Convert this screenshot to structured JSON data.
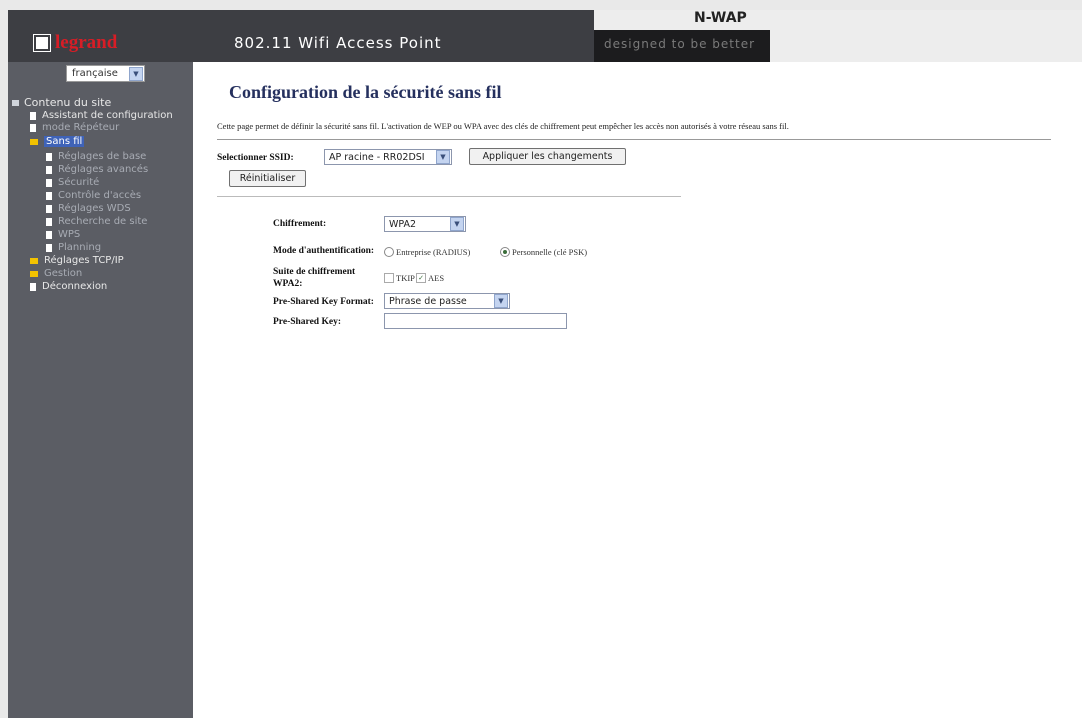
{
  "header": {
    "brand": "legrand",
    "product_title": "802.11 Wifi Access Point",
    "model": "N-WAP",
    "slogan": "designed to be better"
  },
  "sidebar": {
    "language": "française",
    "root": "Contenu du site",
    "items": [
      {
        "label": "Assistant de configuration",
        "type": "page"
      },
      {
        "label": "mode Répéteur",
        "type": "page"
      },
      {
        "label": "Sans fil",
        "type": "folder"
      },
      {
        "label": "Réglages de base",
        "type": "page"
      },
      {
        "label": "Réglages avancés",
        "type": "page"
      },
      {
        "label": "Sécurité",
        "type": "page"
      },
      {
        "label": "Contrôle d'accès",
        "type": "page"
      },
      {
        "label": "Réglages WDS",
        "type": "page"
      },
      {
        "label": "Recherche de site",
        "type": "page"
      },
      {
        "label": "WPS",
        "type": "page"
      },
      {
        "label": "Planning",
        "type": "page"
      },
      {
        "label": "Réglages TCP/IP",
        "type": "folder"
      },
      {
        "label": "Gestion",
        "type": "folder"
      },
      {
        "label": "Déconnexion",
        "type": "page"
      }
    ]
  },
  "main": {
    "title": "Configuration de la sécurité sans fil",
    "description": "Cette page permet de définir la sécurité sans fil. L'activation de WEP ou WPA avec des clés de chiffrement peut empêcher les accès non autorisés à votre réseau sans fil.",
    "ssid_label": "Selectionner SSID:",
    "ssid_value": "AP racine - RR02DSI",
    "apply_button": "Appliquer les changements",
    "reset_button": "Réinitialiser",
    "encryption_label": "Chiffrement:",
    "encryption_value": "WPA2",
    "auth_mode_label": "Mode d'authentification:",
    "auth_options": [
      "Entreprise (RADIUS)",
      "Personnelle (clé PSK)"
    ],
    "auth_selected": "Personnelle (clé PSK)",
    "cipher_label_line1": "Suite de chiffrement",
    "cipher_label_line2": "WPA2:",
    "cipher_options": [
      {
        "label": "TKIP",
        "checked": false
      },
      {
        "label": "AES",
        "checked": true
      }
    ],
    "psk_format_label": "Pre-Shared Key Format:",
    "psk_format_value": "Phrase de passe",
    "psk_label": "Pre-Shared Key:",
    "psk_value": ""
  },
  "colors": {
    "header_dark": "#3d3e43",
    "sidebar_bg": "#5b5d64",
    "brand_red": "#d81d26",
    "title_blue": "#25305e",
    "selection_blue": "#3f63b8"
  }
}
